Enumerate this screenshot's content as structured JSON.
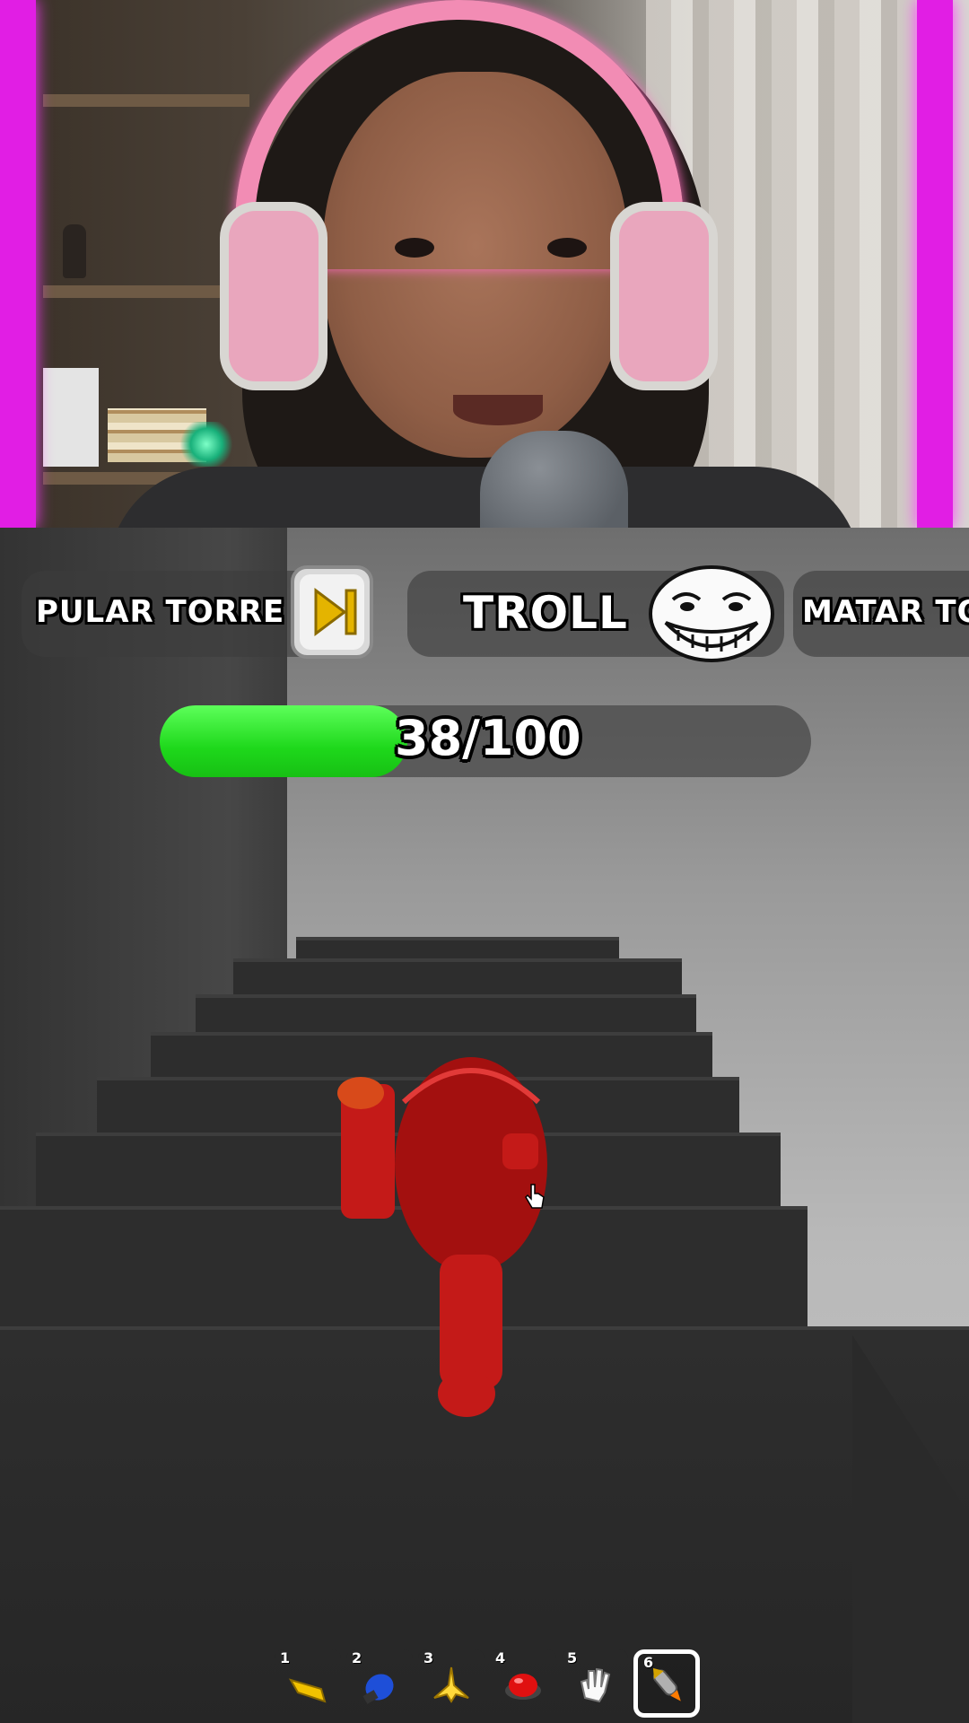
{
  "top_bar": {
    "skip_tower_label": "PULAR TORRE",
    "troll_label": "TROLL",
    "kill_label": "MATAR TO"
  },
  "progress": {
    "current": 38,
    "max": 100,
    "text": "38/100",
    "fill_fraction": 0.38
  },
  "hotbar": {
    "selected_slot": 6,
    "slots": [
      {
        "number": "1",
        "icon": "golden-wedge-icon"
      },
      {
        "number": "2",
        "icon": "blue-glove-icon"
      },
      {
        "number": "3",
        "icon": "banana-icon"
      },
      {
        "number": "4",
        "icon": "red-button-icon"
      },
      {
        "number": "5",
        "icon": "white-glove-icon"
      },
      {
        "number": "6",
        "icon": "rocket-icon"
      }
    ]
  },
  "colors": {
    "neon_frame": "#e11ee4",
    "progress_green": "#1ed81b",
    "player_red": "#c41a18"
  }
}
